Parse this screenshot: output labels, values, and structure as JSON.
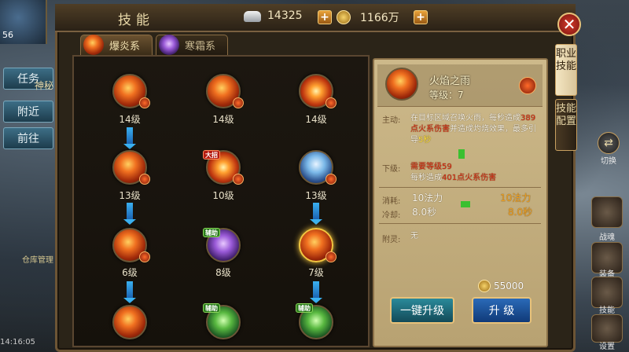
{
  "hud": {
    "player_level": "56",
    "task_tab": "任务",
    "npc_text": "神秘",
    "nearby_btn": "附近",
    "goto_btn": "前往",
    "warehouse": "仓库管理",
    "coords": "14:16:05",
    "switch_label": "切换",
    "right_labels": [
      "战魂",
      "装备",
      "技能",
      "设置"
    ]
  },
  "header": {
    "title": "技能",
    "silver": "14325",
    "gold": "1166万",
    "plus": "+",
    "close": "✕"
  },
  "tabs": [
    {
      "label": "爆炎系"
    },
    {
      "label": "寒霜系"
    }
  ],
  "side_tabs": [
    {
      "label": "职业技能"
    },
    {
      "label": "技能配置"
    }
  ],
  "tree": {
    "levels": [
      "14级",
      "14级",
      "14级",
      "13级",
      "10级",
      "13级",
      "6级",
      "8级",
      "7级"
    ],
    "tags": {
      "ultimate": "大招",
      "assist": "辅助"
    }
  },
  "detail": {
    "name": "火焰之雨",
    "level": "等级：7",
    "active_label": "主动:",
    "active_text_1": "在目标区域召唤火雨，每秒造成",
    "active_dmg": "389点火系伤害",
    "active_text_2": "并造成灼烧效果，最多引导",
    "active_dur": "5秒",
    "next_label": "下级:",
    "next_req": "需要等级59",
    "next_text_1": "每秒造成",
    "next_dmg": "401点火系伤害",
    "cost_label": "消耗:",
    "cost_now": "10法力",
    "cost_next": "10法力",
    "cd_label": "冷却:",
    "cd_now": "8.0秒",
    "cd_next": "8.0秒",
    "attach_label": "附灵:",
    "attach_value": "无",
    "price": "55000",
    "btn_onekey": "一键升级",
    "btn_upgrade": "升 级"
  }
}
